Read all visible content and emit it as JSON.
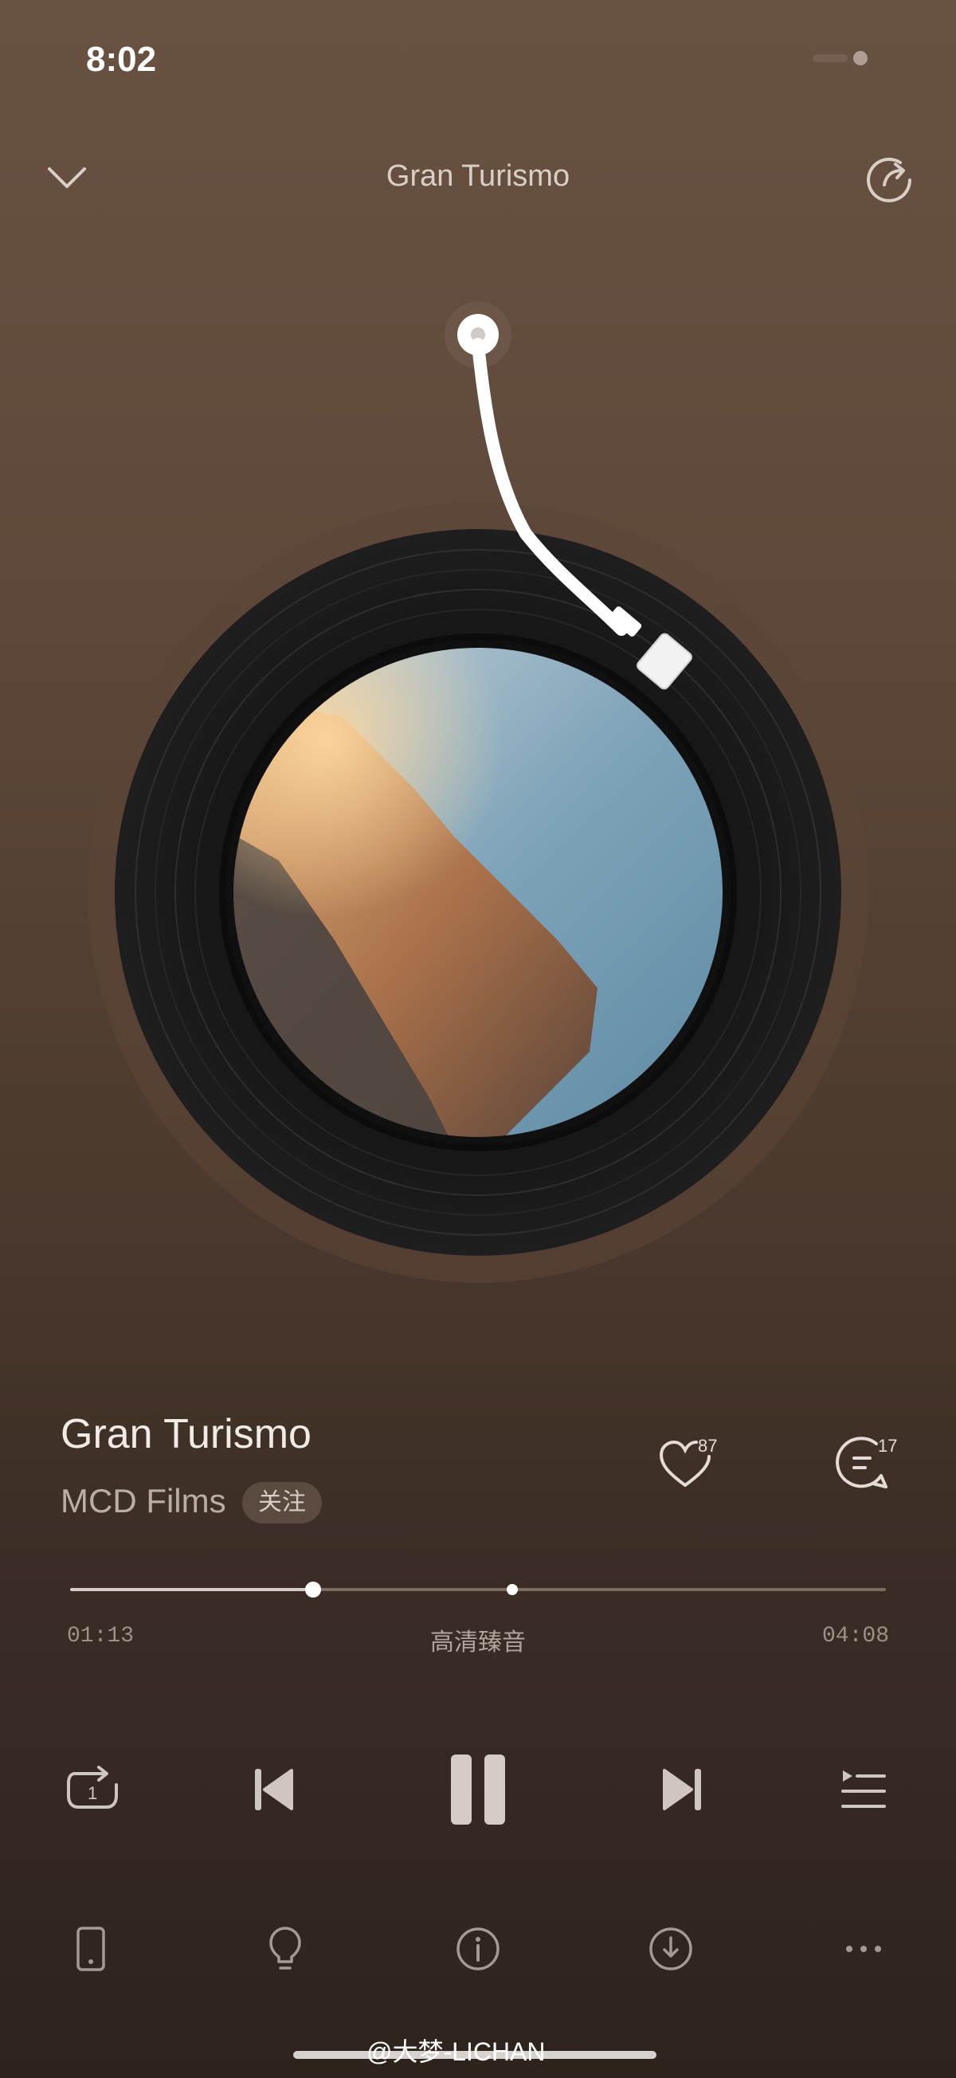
{
  "status_bar": {
    "time": "8:02"
  },
  "header": {
    "title": "Gran Turismo",
    "collapse_icon": "chevron-down-icon",
    "share_icon": "share-icon"
  },
  "track": {
    "title": "Gran Turismo",
    "artist": "MCD Films",
    "follow_label": "关注",
    "like_count": "87",
    "comment_count": "17"
  },
  "progress": {
    "current_time": "01:13",
    "total_time": "04:08",
    "quality_label": "高清臻音",
    "played_fraction": 0.298
  },
  "controls": [
    "repeat-one-icon",
    "previous-icon",
    "pause-icon",
    "next-icon",
    "playlist-icon"
  ],
  "bottom_bar": [
    "device-icon",
    "lightbulb-icon",
    "info-icon",
    "download-icon",
    "more-icon"
  ],
  "watermark": "@大梦-LICHAN",
  "colors": {
    "background_top": "#6a5242",
    "background_bottom": "#2d231d",
    "accent": "#ffffff"
  }
}
